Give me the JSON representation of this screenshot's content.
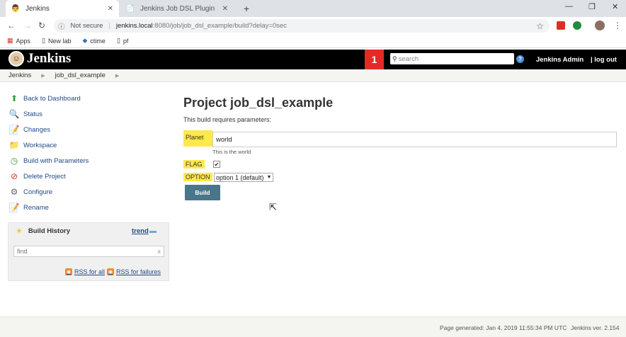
{
  "browser": {
    "tabs": [
      {
        "title": "Jenkins",
        "active": true
      },
      {
        "title": "Jenkins Job DSL Plugin",
        "active": false
      }
    ],
    "new_tab": "+",
    "window_controls": [
      "—",
      "❐",
      "✕"
    ],
    "security": "Not secure",
    "url_host": "jenkins.local",
    "url_path": ":8080/job/job_dsl_example/build?delay=0sec",
    "bookmarks": [
      "Apps",
      "New lab",
      "ctime",
      "pf"
    ]
  },
  "header": {
    "logo": "Jenkins",
    "notifications": "1",
    "search_placeholder": "search",
    "help": "?",
    "user": "Jenkins Admin",
    "logout": "| log out"
  },
  "breadcrumb": [
    "Jenkins",
    "job_dsl_example"
  ],
  "sidebar": {
    "tasks": [
      {
        "label": "Back to Dashboard",
        "icon": "up-arrow-icon"
      },
      {
        "label": "Status",
        "icon": "search-icon"
      },
      {
        "label": "Changes",
        "icon": "notepad-icon"
      },
      {
        "label": "Workspace",
        "icon": "folder-icon"
      },
      {
        "label": "Build with Parameters",
        "icon": "clock-icon"
      },
      {
        "label": "Delete Project",
        "icon": "no-entry-icon"
      },
      {
        "label": "Configure",
        "icon": "gear-icon"
      },
      {
        "label": "Rename",
        "icon": "notepad-icon"
      }
    ],
    "build_history": {
      "title": "Build History",
      "trend": "trend",
      "find_placeholder": "find",
      "clear": "x",
      "rss_all": "RSS for all",
      "rss_failures": "RSS for failures"
    }
  },
  "main": {
    "title": "Project job_dsl_example",
    "subtitle": "This build requires parameters:",
    "params": {
      "planet_label": "Planet",
      "planet_value": "world",
      "planet_desc": "This is the world",
      "flag_label": "FLAG",
      "flag_checked": true,
      "option_label": "OPTION",
      "option_value": "option 1 (default)"
    },
    "build_button": "Build"
  },
  "footer": {
    "generated": "Page generated: Jan 4, 2019 11:55:34 PM UTC",
    "version": "Jenkins ver. 2.154"
  },
  "colors": {
    "header_bg": "#000000",
    "notification": "#e52a26",
    "param_highlight": "#ffe84a",
    "build_button": "#4b758b",
    "link": "#204a87"
  }
}
